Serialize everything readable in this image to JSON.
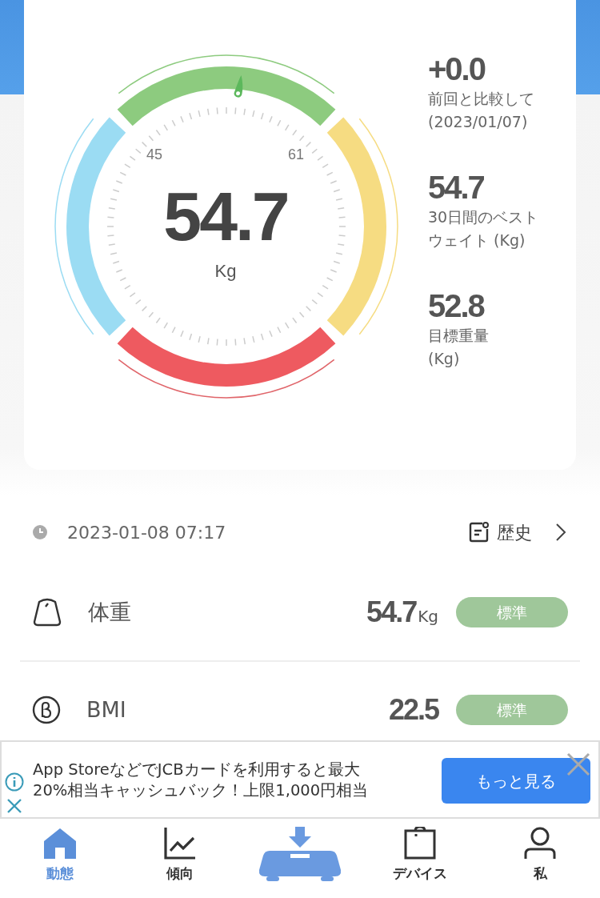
{
  "gauge": {
    "reading": "54.7",
    "unit": "Kg",
    "low_mark": "45",
    "high_mark": "61"
  },
  "stats": [
    {
      "value": "+0.0",
      "label_lines": [
        "前回と比較して",
        "(2023/01/07)"
      ]
    },
    {
      "value": "54.7",
      "label_lines": [
        "30日間のベスト",
        "ウェイト (Kg)"
      ]
    },
    {
      "value": "52.8",
      "label_lines": [
        "目標重量",
        "(Kg)"
      ]
    }
  ],
  "history": {
    "timestamp": "2023-01-08 07:17",
    "link": "歴史"
  },
  "metrics": [
    {
      "kind": "weight",
      "label": "体重",
      "value": "54.7",
      "unit": "Kg",
      "status": "標準"
    },
    {
      "kind": "bmi",
      "label": "BMI",
      "value": "22.5",
      "status": "標準"
    }
  ],
  "ad": {
    "lines": [
      "App StoreなどでJCBカードを利用すると最大",
      "20%相当キャッシュバック！上限1,000円相当"
    ],
    "button": "もっと見る"
  },
  "tabs": [
    {
      "kind": "home",
      "label": "動態",
      "selected": true
    },
    {
      "kind": "trend",
      "label": "傾向",
      "selected": false
    },
    {
      "kind": "scale",
      "selected": false
    },
    {
      "kind": "shop",
      "label": "デバイス",
      "selected": false
    },
    {
      "kind": "me",
      "label": "私",
      "selected": false
    }
  ]
}
